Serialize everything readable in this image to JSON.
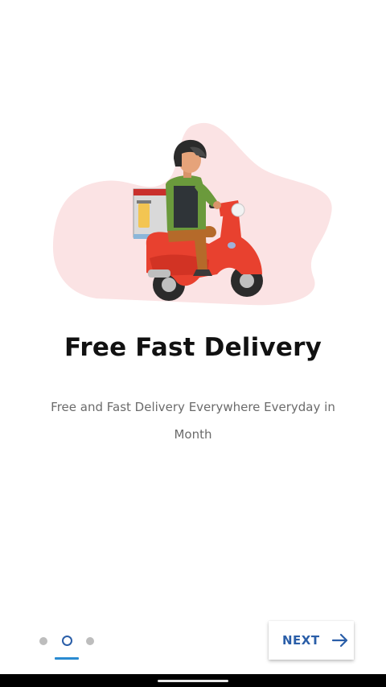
{
  "onboarding": {
    "title": "Free Fast Delivery",
    "subtitle": "Free and Fast Delivery Everywhere Everyday in Month",
    "illustration_icon": "delivery-scooter-illustration"
  },
  "pager": {
    "page_count": 3,
    "current_page": 2,
    "active_color": "#2a5ea8",
    "inactive_color": "#bdbdbd",
    "underline_color": "#2a8bd1"
  },
  "next_button": {
    "label": "NEXT",
    "icon": "arrow-right-icon",
    "color": "#2a5ea8"
  },
  "colors": {
    "blob": "#fbe3e4",
    "scooter": "#e8412f",
    "background": "#ffffff"
  }
}
